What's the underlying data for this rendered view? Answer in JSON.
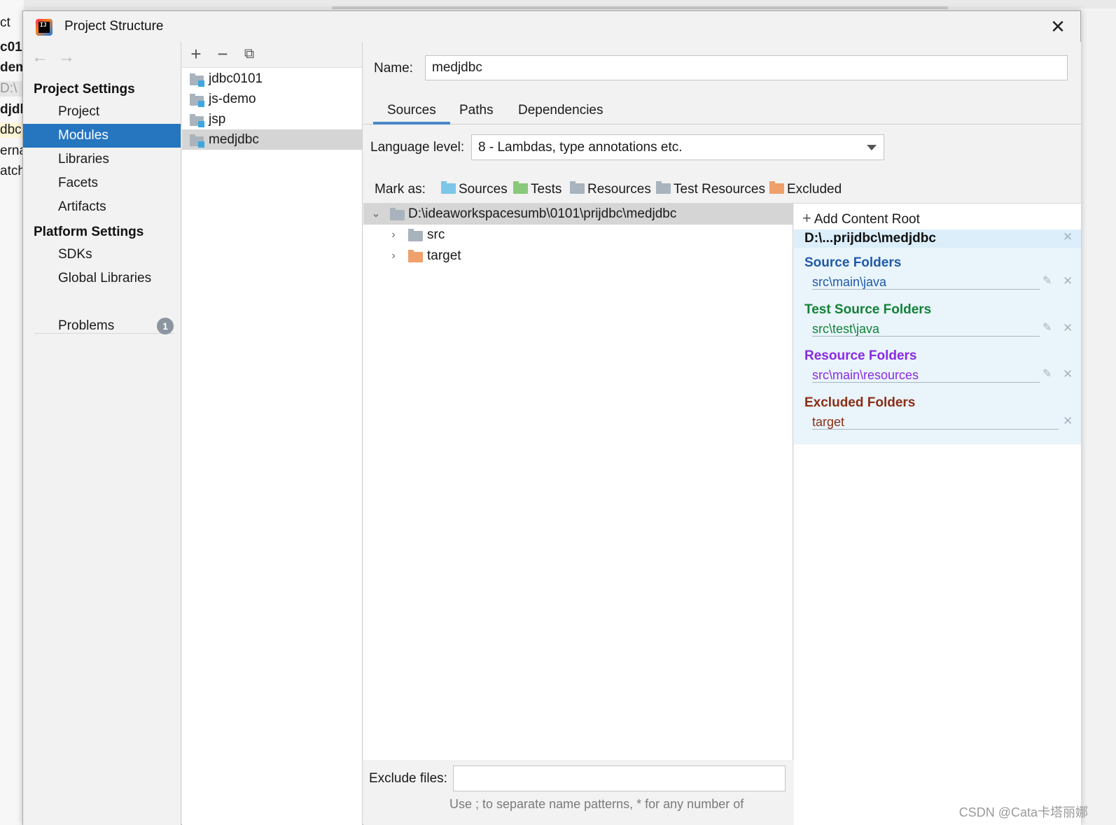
{
  "background": {
    "side_text": [
      "ct",
      "c01",
      "dem",
      "D:\\",
      "djdl",
      "dbc",
      "erna",
      "atch"
    ]
  },
  "window": {
    "title": "Project Structure",
    "close": "✕"
  },
  "nav": {
    "back": "←",
    "forward": "→",
    "project_settings_heading": "Project Settings",
    "project_items": [
      "Project",
      "Modules",
      "Libraries",
      "Facets",
      "Artifacts"
    ],
    "selected": "Modules",
    "platform_settings_heading": "Platform Settings",
    "platform_items": [
      "SDKs",
      "Global Libraries"
    ],
    "problems_label": "Problems",
    "problems_count": "1"
  },
  "modules": {
    "toolbar": {
      "add": "+",
      "remove": "−",
      "copy": "⧉"
    },
    "items": [
      "jdbc0101",
      "js-demo",
      "jsp",
      "medjdbc"
    ],
    "selected": "medjdbc"
  },
  "module_detail": {
    "name_label": "Name:",
    "name_value": "medjdbc",
    "tabs": [
      "Sources",
      "Paths",
      "Dependencies"
    ],
    "active_tab": "Sources",
    "language_level_label": "Language level:",
    "language_level_value": "8 - Lambdas, type annotations etc.",
    "mark_as_label": "Mark as:",
    "mark_as": [
      {
        "label": "Sources",
        "color": "#7cc6e8"
      },
      {
        "label": "Tests",
        "color": "#8ac97a"
      },
      {
        "label": "Resources",
        "color": "#a9b3bd"
      },
      {
        "label": "Test Resources",
        "color": "#a9b3bd"
      },
      {
        "label": "Excluded",
        "color": "#f0a06a"
      }
    ],
    "tree": {
      "root": "D:\\ideaworkspacesumb\\0101\\prijdbc\\medjdbc",
      "children": [
        "src",
        "target"
      ]
    },
    "exclude_files_label": "Exclude files:",
    "exclude_files_value": "",
    "exclude_hint": "Use ; to separate name patterns, * for any number of"
  },
  "content_roots": {
    "add_label": "Add Content Root",
    "root_label": "D:\\...prijdbc\\medjdbc",
    "groups": [
      {
        "title": "Source Folders",
        "path": "src\\main\\java",
        "color": "#1f5aa8"
      },
      {
        "title": "Test Source Folders",
        "path": "src\\test\\java",
        "color": "#128235"
      },
      {
        "title": "Resource Folders",
        "path": "src\\main\\resources",
        "color": "#8a2be2"
      },
      {
        "title": "Excluded Folders",
        "path": "target",
        "color": "#8b2e14"
      }
    ]
  },
  "watermark": "CSDN @Cata卡塔丽娜"
}
